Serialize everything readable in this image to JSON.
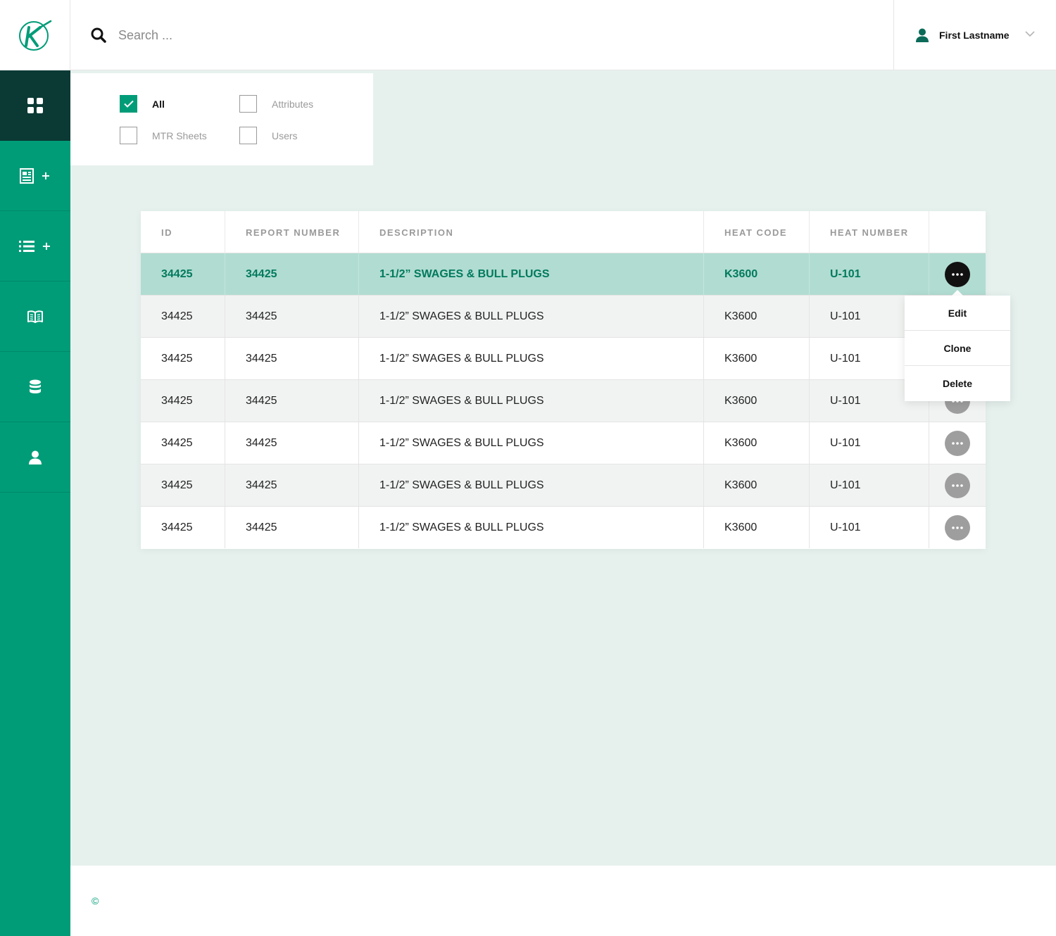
{
  "brand": {
    "logo_letter": "K",
    "accent": "#009c78",
    "dark": "#0b3a35"
  },
  "sidebar": {
    "items": [
      {
        "icon": "dashboard-grid-icon",
        "active": true
      },
      {
        "icon": "add-report-icon",
        "plus": "+"
      },
      {
        "icon": "add-list-icon",
        "plus": "+"
      },
      {
        "icon": "book-icon"
      },
      {
        "icon": "database-icon"
      },
      {
        "icon": "user-icon"
      }
    ]
  },
  "header": {
    "search_placeholder": "Search ...",
    "user_name": "First Lastname"
  },
  "filters": {
    "all": {
      "label": "All",
      "checked": true
    },
    "attributes": {
      "label": "Attributes",
      "checked": false
    },
    "mtr_sheets": {
      "label": "MTR Sheets",
      "checked": false
    },
    "users": {
      "label": "Users",
      "checked": false
    }
  },
  "table": {
    "columns": [
      "ID",
      "REPORT NUMBER",
      "DESCRIPTION",
      "HEAT CODE",
      "HEAT NUMBER"
    ],
    "rows": [
      {
        "id": "34425",
        "report_number": "34425",
        "description": "1-1/2” SWAGES & BULL PLUGS",
        "heat_code": "K3600",
        "heat_number": "U-101"
      },
      {
        "id": "34425",
        "report_number": "34425",
        "description": "1-1/2” SWAGES & BULL PLUGS",
        "heat_code": "K3600",
        "heat_number": "U-101"
      },
      {
        "id": "34425",
        "report_number": "34425",
        "description": "1-1/2” SWAGES & BULL PLUGS",
        "heat_code": "K3600",
        "heat_number": "U-101"
      },
      {
        "id": "34425",
        "report_number": "34425",
        "description": "1-1/2” SWAGES & BULL PLUGS",
        "heat_code": "K3600",
        "heat_number": "U-101"
      },
      {
        "id": "34425",
        "report_number": "34425",
        "description": "1-1/2” SWAGES & BULL PLUGS",
        "heat_code": "K3600",
        "heat_number": "U-101"
      },
      {
        "id": "34425",
        "report_number": "34425",
        "description": "1-1/2” SWAGES & BULL PLUGS",
        "heat_code": "K3600",
        "heat_number": "U-101"
      },
      {
        "id": "34425",
        "report_number": "34425",
        "description": "1-1/2” SWAGES & BULL PLUGS",
        "heat_code": "K3600",
        "heat_number": "U-101"
      }
    ]
  },
  "row_menu": {
    "edit": "Edit",
    "clone": "Clone",
    "delete": "Delete"
  },
  "footer": {
    "copyright": "©"
  }
}
